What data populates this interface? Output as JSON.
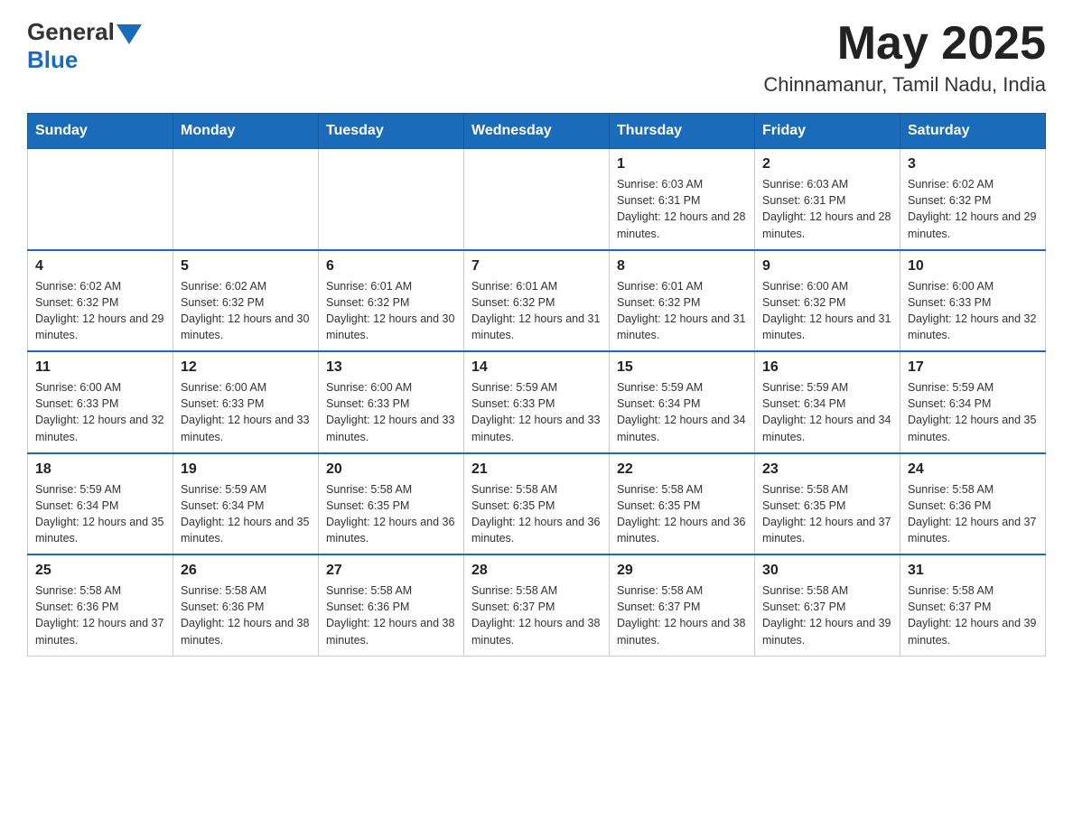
{
  "header": {
    "logo": {
      "general": "General",
      "blue": "Blue"
    },
    "month": "May 2025",
    "location": "Chinnamanur, Tamil Nadu, India"
  },
  "days_of_week": [
    "Sunday",
    "Monday",
    "Tuesday",
    "Wednesday",
    "Thursday",
    "Friday",
    "Saturday"
  ],
  "weeks": [
    [
      {
        "day": "",
        "sunrise": "",
        "sunset": "",
        "daylight": ""
      },
      {
        "day": "",
        "sunrise": "",
        "sunset": "",
        "daylight": ""
      },
      {
        "day": "",
        "sunrise": "",
        "sunset": "",
        "daylight": ""
      },
      {
        "day": "",
        "sunrise": "",
        "sunset": "",
        "daylight": ""
      },
      {
        "day": "1",
        "sunrise": "Sunrise: 6:03 AM",
        "sunset": "Sunset: 6:31 PM",
        "daylight": "Daylight: 12 hours and 28 minutes."
      },
      {
        "day": "2",
        "sunrise": "Sunrise: 6:03 AM",
        "sunset": "Sunset: 6:31 PM",
        "daylight": "Daylight: 12 hours and 28 minutes."
      },
      {
        "day": "3",
        "sunrise": "Sunrise: 6:02 AM",
        "sunset": "Sunset: 6:32 PM",
        "daylight": "Daylight: 12 hours and 29 minutes."
      }
    ],
    [
      {
        "day": "4",
        "sunrise": "Sunrise: 6:02 AM",
        "sunset": "Sunset: 6:32 PM",
        "daylight": "Daylight: 12 hours and 29 minutes."
      },
      {
        "day": "5",
        "sunrise": "Sunrise: 6:02 AM",
        "sunset": "Sunset: 6:32 PM",
        "daylight": "Daylight: 12 hours and 30 minutes."
      },
      {
        "day": "6",
        "sunrise": "Sunrise: 6:01 AM",
        "sunset": "Sunset: 6:32 PM",
        "daylight": "Daylight: 12 hours and 30 minutes."
      },
      {
        "day": "7",
        "sunrise": "Sunrise: 6:01 AM",
        "sunset": "Sunset: 6:32 PM",
        "daylight": "Daylight: 12 hours and 31 minutes."
      },
      {
        "day": "8",
        "sunrise": "Sunrise: 6:01 AM",
        "sunset": "Sunset: 6:32 PM",
        "daylight": "Daylight: 12 hours and 31 minutes."
      },
      {
        "day": "9",
        "sunrise": "Sunrise: 6:00 AM",
        "sunset": "Sunset: 6:32 PM",
        "daylight": "Daylight: 12 hours and 31 minutes."
      },
      {
        "day": "10",
        "sunrise": "Sunrise: 6:00 AM",
        "sunset": "Sunset: 6:33 PM",
        "daylight": "Daylight: 12 hours and 32 minutes."
      }
    ],
    [
      {
        "day": "11",
        "sunrise": "Sunrise: 6:00 AM",
        "sunset": "Sunset: 6:33 PM",
        "daylight": "Daylight: 12 hours and 32 minutes."
      },
      {
        "day": "12",
        "sunrise": "Sunrise: 6:00 AM",
        "sunset": "Sunset: 6:33 PM",
        "daylight": "Daylight: 12 hours and 33 minutes."
      },
      {
        "day": "13",
        "sunrise": "Sunrise: 6:00 AM",
        "sunset": "Sunset: 6:33 PM",
        "daylight": "Daylight: 12 hours and 33 minutes."
      },
      {
        "day": "14",
        "sunrise": "Sunrise: 5:59 AM",
        "sunset": "Sunset: 6:33 PM",
        "daylight": "Daylight: 12 hours and 33 minutes."
      },
      {
        "day": "15",
        "sunrise": "Sunrise: 5:59 AM",
        "sunset": "Sunset: 6:34 PM",
        "daylight": "Daylight: 12 hours and 34 minutes."
      },
      {
        "day": "16",
        "sunrise": "Sunrise: 5:59 AM",
        "sunset": "Sunset: 6:34 PM",
        "daylight": "Daylight: 12 hours and 34 minutes."
      },
      {
        "day": "17",
        "sunrise": "Sunrise: 5:59 AM",
        "sunset": "Sunset: 6:34 PM",
        "daylight": "Daylight: 12 hours and 35 minutes."
      }
    ],
    [
      {
        "day": "18",
        "sunrise": "Sunrise: 5:59 AM",
        "sunset": "Sunset: 6:34 PM",
        "daylight": "Daylight: 12 hours and 35 minutes."
      },
      {
        "day": "19",
        "sunrise": "Sunrise: 5:59 AM",
        "sunset": "Sunset: 6:34 PM",
        "daylight": "Daylight: 12 hours and 35 minutes."
      },
      {
        "day": "20",
        "sunrise": "Sunrise: 5:58 AM",
        "sunset": "Sunset: 6:35 PM",
        "daylight": "Daylight: 12 hours and 36 minutes."
      },
      {
        "day": "21",
        "sunrise": "Sunrise: 5:58 AM",
        "sunset": "Sunset: 6:35 PM",
        "daylight": "Daylight: 12 hours and 36 minutes."
      },
      {
        "day": "22",
        "sunrise": "Sunrise: 5:58 AM",
        "sunset": "Sunset: 6:35 PM",
        "daylight": "Daylight: 12 hours and 36 minutes."
      },
      {
        "day": "23",
        "sunrise": "Sunrise: 5:58 AM",
        "sunset": "Sunset: 6:35 PM",
        "daylight": "Daylight: 12 hours and 37 minutes."
      },
      {
        "day": "24",
        "sunrise": "Sunrise: 5:58 AM",
        "sunset": "Sunset: 6:36 PM",
        "daylight": "Daylight: 12 hours and 37 minutes."
      }
    ],
    [
      {
        "day": "25",
        "sunrise": "Sunrise: 5:58 AM",
        "sunset": "Sunset: 6:36 PM",
        "daylight": "Daylight: 12 hours and 37 minutes."
      },
      {
        "day": "26",
        "sunrise": "Sunrise: 5:58 AM",
        "sunset": "Sunset: 6:36 PM",
        "daylight": "Daylight: 12 hours and 38 minutes."
      },
      {
        "day": "27",
        "sunrise": "Sunrise: 5:58 AM",
        "sunset": "Sunset: 6:36 PM",
        "daylight": "Daylight: 12 hours and 38 minutes."
      },
      {
        "day": "28",
        "sunrise": "Sunrise: 5:58 AM",
        "sunset": "Sunset: 6:37 PM",
        "daylight": "Daylight: 12 hours and 38 minutes."
      },
      {
        "day": "29",
        "sunrise": "Sunrise: 5:58 AM",
        "sunset": "Sunset: 6:37 PM",
        "daylight": "Daylight: 12 hours and 38 minutes."
      },
      {
        "day": "30",
        "sunrise": "Sunrise: 5:58 AM",
        "sunset": "Sunset: 6:37 PM",
        "daylight": "Daylight: 12 hours and 39 minutes."
      },
      {
        "day": "31",
        "sunrise": "Sunrise: 5:58 AM",
        "sunset": "Sunset: 6:37 PM",
        "daylight": "Daylight: 12 hours and 39 minutes."
      }
    ]
  ]
}
